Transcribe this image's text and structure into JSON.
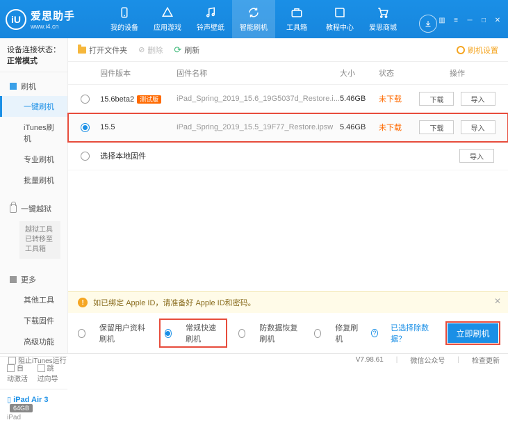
{
  "brand": {
    "name": "爱思助手",
    "site": "www.i4.cn",
    "logo_letter": "iU"
  },
  "nav": [
    {
      "label": "我的设备"
    },
    {
      "label": "应用游戏"
    },
    {
      "label": "铃声壁纸"
    },
    {
      "label": "智能刷机",
      "active": true
    },
    {
      "label": "工具箱"
    },
    {
      "label": "教程中心"
    },
    {
      "label": "爱思商城"
    }
  ],
  "sidebar": {
    "status_label": "设备连接状态：",
    "status_value": "正常模式",
    "sections": [
      {
        "title": "刷机",
        "icon": "square",
        "items": [
          "一键刷机",
          "iTunes刷机",
          "专业刷机",
          "批量刷机"
        ],
        "active_index": 0
      },
      {
        "title": "一键越狱",
        "icon": "lock",
        "note": "越狱工具已转移至工具箱"
      },
      {
        "title": "更多",
        "icon": "square",
        "items": [
          "其他工具",
          "下载固件",
          "高级功能"
        ]
      }
    ],
    "bottom_opts": [
      "自动激活",
      "跳过向导"
    ],
    "device": {
      "name": "iPad Air 3",
      "badge": "64GB",
      "sub": "iPad"
    }
  },
  "toolbar": {
    "open_folder": "打开文件夹",
    "delete": "删除",
    "refresh": "刷新",
    "settings": "刷机设置"
  },
  "table": {
    "headers": {
      "version": "固件版本",
      "name": "固件名称",
      "size": "大小",
      "status": "状态",
      "ops": "操作"
    },
    "rows": [
      {
        "version": "15.6beta2",
        "beta": "测试版",
        "name": "iPad_Spring_2019_15.6_19G5037d_Restore.i...",
        "size": "5.46GB",
        "status": "未下载",
        "selected": false,
        "ops": [
          "下载",
          "导入"
        ]
      },
      {
        "version": "15.5",
        "name": "iPad_Spring_2019_15.5_19F77_Restore.ipsw",
        "size": "5.46GB",
        "status": "未下载",
        "selected": true,
        "ops": [
          "下载",
          "导入"
        ]
      }
    ],
    "local_row": {
      "label": "选择本地固件",
      "op": "导入"
    }
  },
  "notice": "如已绑定 Apple ID，请准备好 Apple ID和密码。",
  "modes": {
    "opts": [
      "保留用户资料刷机",
      "常规快速刷机",
      "防数据恢复刷机",
      "修复刷机"
    ],
    "selected_index": 1,
    "link": "已选择除数据？",
    "button": "立即刷机"
  },
  "footer": {
    "block_itunes": "阻止iTunes运行",
    "version": "V7.98.61",
    "wechat": "微信公众号",
    "check_update": "检查更新"
  }
}
